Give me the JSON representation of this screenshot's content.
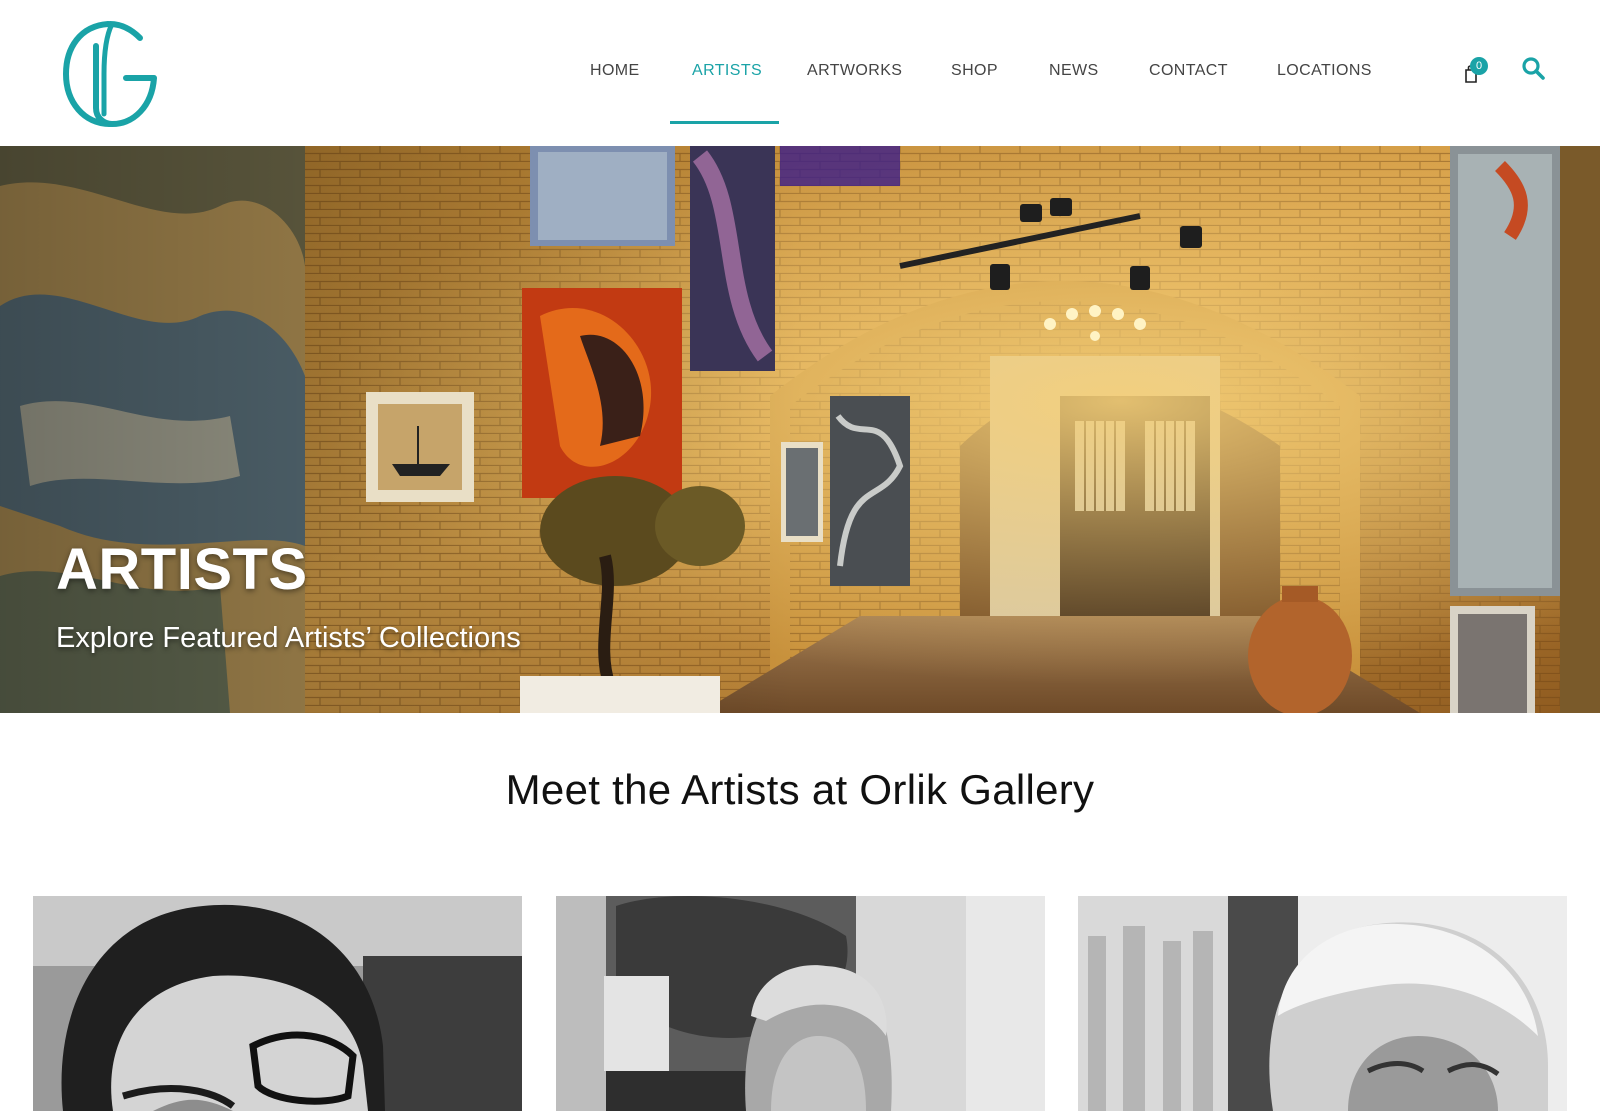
{
  "brand": {
    "accent_color": "#1aa3a7",
    "logo_icon": "og-monogram-icon"
  },
  "nav": {
    "items": [
      {
        "label": "HOME",
        "active": false
      },
      {
        "label": "ARTISTS",
        "active": true
      },
      {
        "label": "ARTWORKS",
        "active": false
      },
      {
        "label": "SHOP",
        "active": false
      },
      {
        "label": "NEWS",
        "active": false
      },
      {
        "label": "CONTACT",
        "active": false
      },
      {
        "label": "LOCATIONS",
        "active": false
      }
    ],
    "cart_count": "0",
    "cart_icon": "shopping-bag-icon",
    "search_icon": "search-icon"
  },
  "hero": {
    "title": "ARTISTS",
    "subtitle": "Explore Featured Artists’ Collections"
  },
  "section": {
    "heading": "Meet the Artists at Orlik Gallery"
  },
  "artists": [
    {
      "photo": "artist-portrait-1"
    },
    {
      "photo": "artist-portrait-2"
    },
    {
      "photo": "artist-portrait-3"
    }
  ]
}
